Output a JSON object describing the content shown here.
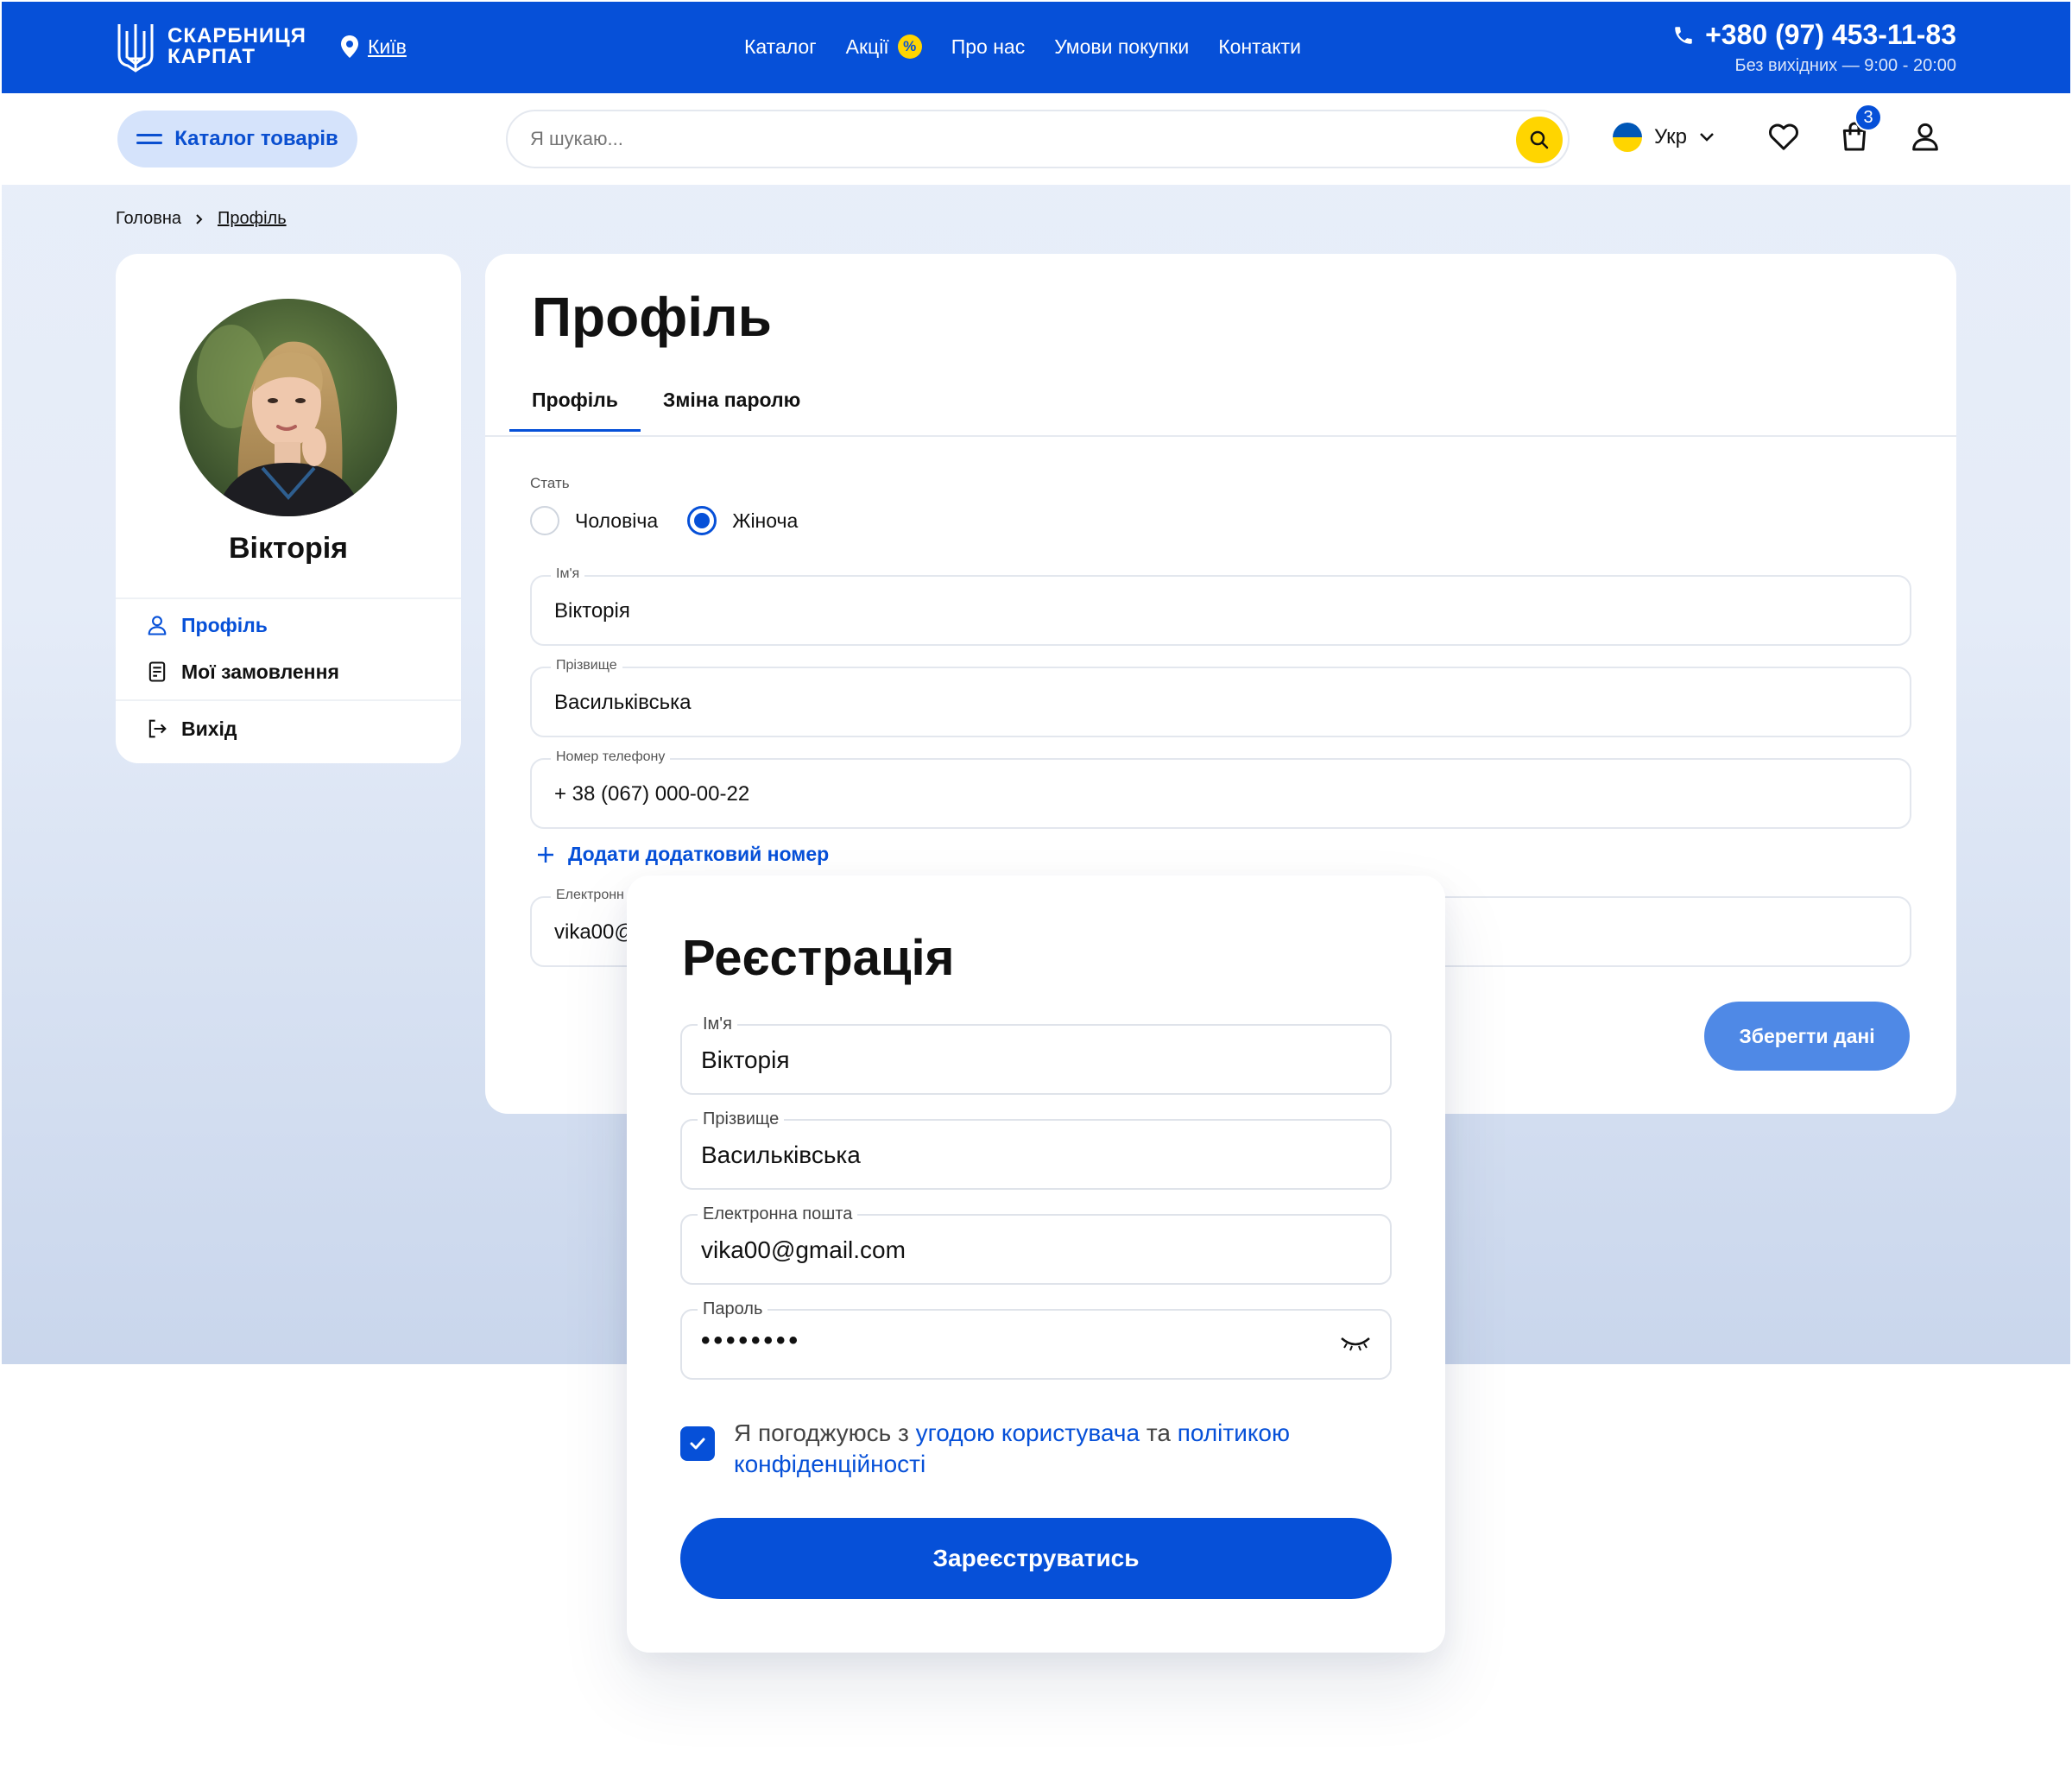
{
  "header": {
    "logo_line1": "СКАРБНИЦЯ",
    "logo_line2": "КАРПАТ",
    "city": "Київ",
    "nav": [
      "Каталог",
      "Акції",
      "Про нас",
      "Умови покупки",
      "Контакти"
    ],
    "promo_badge": "%",
    "phone": "+380 (97) 453-11-83",
    "hours": "Без вихідних — 9:00 - 20:00"
  },
  "toolbar": {
    "catalog_label": "Каталог товарів",
    "search_placeholder": "Я шукаю...",
    "language": "Укр",
    "cart_count": "3"
  },
  "breadcrumb": {
    "home": "Головна",
    "current": "Профіль"
  },
  "sidebar": {
    "user_name": "Вікторія",
    "items": [
      {
        "label": "Профіль",
        "icon": "user-icon",
        "active": true
      },
      {
        "label": "Мої замовлення",
        "icon": "orders-icon",
        "active": false
      },
      {
        "label": "Вихід",
        "icon": "logout-icon",
        "active": false
      }
    ]
  },
  "profile": {
    "title": "Профіль",
    "tabs": [
      "Профіль",
      "Зміна паролю"
    ],
    "gender_label": "Стать",
    "gender_options": [
      "Чоловіча",
      "Жіноча"
    ],
    "gender_selected": "Жіноча",
    "first_name_label": "Ім'я",
    "first_name": "Вікторія",
    "last_name_label": "Прізвище",
    "last_name": "Васильківська",
    "phone_label": "Номер телефону",
    "phone": "+ 38 (067) 000-00-22",
    "add_phone": "Додати додатковий номер",
    "email_label": "Електронн",
    "email": "vika00@",
    "save_label": "Зберегти дані"
  },
  "registration": {
    "title": "Реєстрація",
    "first_name_label": "Ім'я",
    "first_name": "Вікторія",
    "last_name_label": "Прізвище",
    "last_name": "Васильківська",
    "email_label": "Електронна пошта",
    "email": "vika00@gmail.com",
    "password_label": "Пароль",
    "password_mask": "••••••••",
    "agree_prefix": "Я погоджуюсь з ",
    "agree_link1": "угодою користувача",
    "agree_mid": " та ",
    "agree_link2": "політикою конфіденційності",
    "agree_checked": true,
    "submit_label": "Зареєструватись"
  },
  "colors": {
    "primary": "#0650d8",
    "accent": "#ffd500",
    "save_button": "#4f89e6",
    "background": "#e8eef9"
  }
}
